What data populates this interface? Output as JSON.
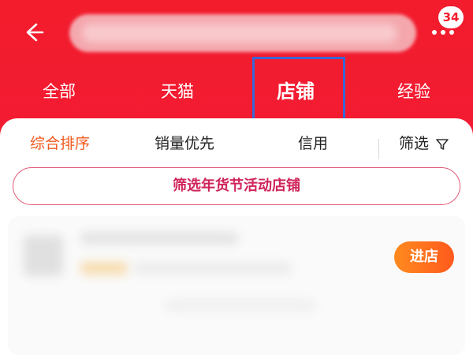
{
  "header": {
    "badge_count": "34",
    "icons": {
      "back": "back-arrow-icon",
      "more": "more-dots-icon"
    }
  },
  "tabs": [
    {
      "label": "全部"
    },
    {
      "label": "天猫"
    },
    {
      "label": "店铺",
      "active": true
    },
    {
      "label": "经验"
    }
  ],
  "sort": {
    "items": [
      {
        "label": "综合排序",
        "active": true
      },
      {
        "label": "销量优先"
      },
      {
        "label": "信用"
      }
    ],
    "filter_label": "筛选"
  },
  "promo": {
    "label": "筛选年货节活动店铺"
  },
  "shop": {
    "enter_label": "进店"
  },
  "colors": {
    "header_red": "#f21c2c",
    "active_orange": "#f25a1f",
    "promo_pink": "#d0235a",
    "highlight_blue": "#3a66d6"
  }
}
